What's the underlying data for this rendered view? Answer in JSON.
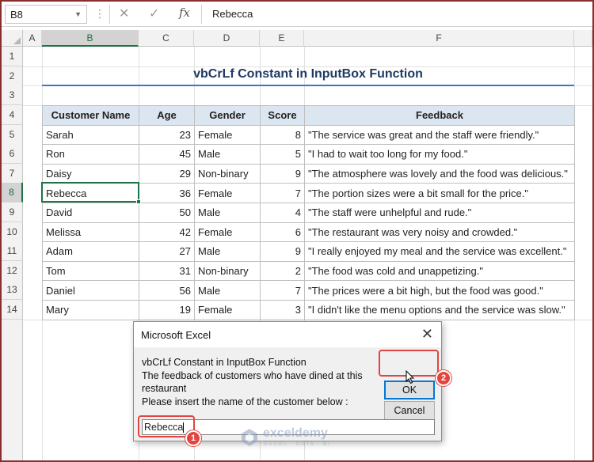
{
  "formula_bar": {
    "name_box": "B8",
    "fx_label": "fx",
    "content": "Rebecca"
  },
  "columns": [
    "A",
    "B",
    "C",
    "D",
    "E",
    "F"
  ],
  "rows": [
    "1",
    "2",
    "3",
    "4",
    "5",
    "6",
    "7",
    "8",
    "9",
    "10",
    "11",
    "12",
    "13",
    "14"
  ],
  "sheet": {
    "title": "vbCrLf Constant in InputBox Function",
    "headers": [
      "Customer Name",
      "Age",
      "Gender",
      "Score",
      "Feedback"
    ],
    "records": [
      [
        "Sarah",
        "23",
        "Female",
        "8",
        "\"The service was great and the staff were friendly.\""
      ],
      [
        "Ron",
        "45",
        "Male",
        "5",
        "\"I had to wait too long for my food.\""
      ],
      [
        "Daisy",
        "29",
        "Non-binary",
        "9",
        "\"The atmosphere was lovely and the food was delicious.\""
      ],
      [
        "Rebecca",
        "36",
        "Female",
        "7",
        "\"The portion sizes were a bit small for the price.\""
      ],
      [
        "David",
        "50",
        "Male",
        "4",
        "\"The staff were unhelpful and rude.\""
      ],
      [
        "Melissa",
        "42",
        "Female",
        "6",
        "\"The restaurant was very noisy and crowded.\""
      ],
      [
        "Adam",
        "27",
        "Male",
        "9",
        "\"I really enjoyed my meal and the service was excellent.\""
      ],
      [
        "Tom",
        "31",
        "Non-binary",
        "2",
        "\"The food was cold and unappetizing.\""
      ],
      [
        "Daniel",
        "56",
        "Male",
        "7",
        "\"The prices were a bit high, but the food was good.\""
      ],
      [
        "Mary",
        "19",
        "Female",
        "3",
        "\"I didn't like the menu options and the service was slow.\""
      ]
    ]
  },
  "dialog": {
    "title": "Microsoft Excel",
    "close_glyph": "✕",
    "prompt_lines": [
      "vbCrLf Constant in InputBox Function",
      "The feedback of customers who have dined at this",
      "restaurant",
      "Please insert the name of the customer below :"
    ],
    "ok_label": "OK",
    "cancel_label": "Cancel",
    "input_value": "Rebecca"
  },
  "callouts": {
    "step1": "1",
    "step2": "2",
    "color": "#e0453f"
  },
  "watermark": {
    "name": "exceldemy",
    "tagline": "EXCEL · DATA · BI"
  },
  "icons": {
    "cancel": "cancel-icon",
    "enter": "enter-icon",
    "function": "fx-icon"
  },
  "colors": {
    "accent_green": "#217346",
    "header_fill": "#dce6f1",
    "title_underline": "#4472c4"
  }
}
